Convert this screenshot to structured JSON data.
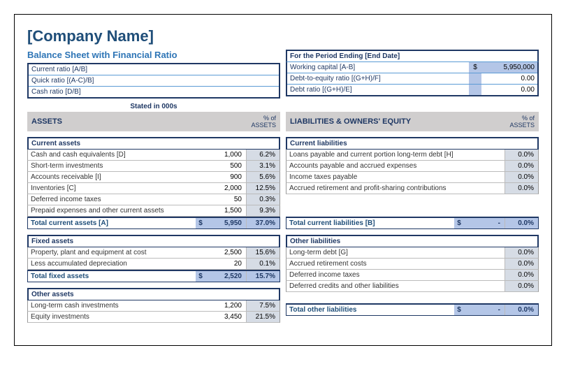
{
  "company": "[Company Name]",
  "subtitle": "Balance Sheet with Financial Ratio",
  "period": "For the Period Ending [End Date]",
  "stated": "Stated in 000s",
  "left_ratios": [
    {
      "label": "Current ratio [A/B]",
      "val": ""
    },
    {
      "label": "Quick ratio [(A-C)/B]",
      "val": ""
    },
    {
      "label": "Cash ratio [D/B]",
      "val": ""
    }
  ],
  "right_ratios": [
    {
      "label": "Working capital [A-B]",
      "cur": "$",
      "val": "5,950,000",
      "hl": true
    },
    {
      "label": "Debt-to-equity ratio [(G+H)/F]",
      "cur": "",
      "val": "0.00"
    },
    {
      "label": "Debt ratio [(G+H)/E]",
      "cur": "",
      "val": "0.00"
    }
  ],
  "assets_header": "ASSETS",
  "liab_header": "LIABILITIES & OWNERS' EQUITY",
  "pct_label": "% of ASSETS",
  "current_assets": {
    "title": "Current assets",
    "rows": [
      {
        "label": "Cash and cash equivalents [D]",
        "val": "1,000",
        "pct": "6.2%"
      },
      {
        "label": "Short-term investments",
        "val": "500",
        "pct": "3.1%"
      },
      {
        "label": "Accounts receivable [I]",
        "val": "900",
        "pct": "5.6%"
      },
      {
        "label": "Inventories [C]",
        "val": "2,000",
        "pct": "12.5%"
      },
      {
        "label": "Deferred income taxes",
        "val": "50",
        "pct": "0.3%"
      },
      {
        "label": "Prepaid expenses and other current assets",
        "val": "1,500",
        "pct": "9.3%"
      }
    ],
    "total": {
      "label": "Total current assets [A]",
      "cur": "$",
      "val": "5,950",
      "pct": "37.0%"
    }
  },
  "fixed_assets": {
    "title": "Fixed assets",
    "rows": [
      {
        "label": "Property, plant and equipment at cost",
        "val": "2,500",
        "pct": "15.6%"
      },
      {
        "label": "Less accumulated depreciation",
        "val": "20",
        "pct": "0.1%"
      }
    ],
    "total": {
      "label": "Total fixed assets",
      "cur": "$",
      "val": "2,520",
      "pct": "15.7%"
    }
  },
  "other_assets": {
    "title": "Other assets",
    "rows": [
      {
        "label": "Long-term cash investments",
        "val": "1,200",
        "pct": "7.5%"
      },
      {
        "label": "Equity investments",
        "val": "3,450",
        "pct": "21.5%"
      }
    ]
  },
  "current_liab": {
    "title": "Current liabilities",
    "rows": [
      {
        "label": "Loans payable and current portion long-term debt [H]",
        "val": "",
        "pct": "0.0%"
      },
      {
        "label": "Accounts payable and accrued expenses",
        "val": "",
        "pct": "0.0%"
      },
      {
        "label": "Income taxes payable",
        "val": "",
        "pct": "0.0%"
      },
      {
        "label": "Accrued retirement and profit-sharing contributions",
        "val": "",
        "pct": "0.0%"
      }
    ],
    "total": {
      "label": "Total current liabilities [B]",
      "cur": "$",
      "val": "-",
      "pct": "0.0%"
    }
  },
  "other_liab": {
    "title": "Other liabilities",
    "rows": [
      {
        "label": "Long-term debt [G]",
        "val": "",
        "pct": "0.0%"
      },
      {
        "label": "Accrued retirement costs",
        "val": "",
        "pct": "0.0%"
      },
      {
        "label": "Deferred income taxes",
        "val": "",
        "pct": "0.0%"
      },
      {
        "label": "Deferred credits and other liabilities",
        "val": "",
        "pct": "0.0%"
      }
    ],
    "total": {
      "label": "Total other liabilities",
      "cur": "$",
      "val": "-",
      "pct": "0.0%"
    }
  }
}
